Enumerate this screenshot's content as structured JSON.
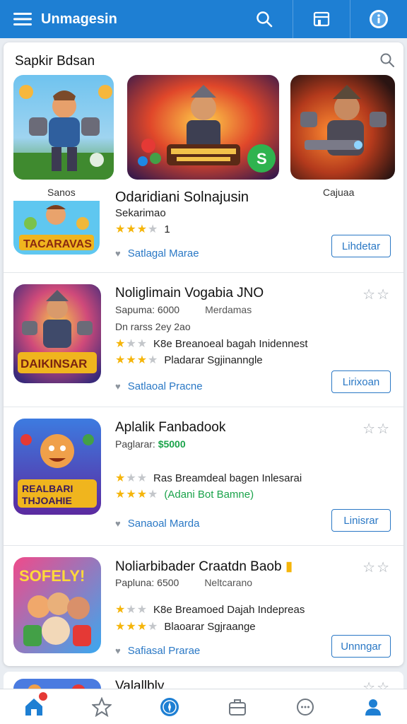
{
  "header": {
    "title": "Unmagesin",
    "menu_icon": "menu-icon",
    "search_icon": "search-icon",
    "store_icon": "store-icon",
    "info_icon": "info-icon",
    "color": "#1e7fd3"
  },
  "panel": {
    "title": "Sapkir Bdsan",
    "search_icon": "search-icon"
  },
  "featured": [
    {
      "label": "Sanos"
    },
    {
      "label": ""
    },
    {
      "label": "Cajuaa"
    }
  ],
  "partial": {
    "name": "Odaridiani Solnajusin",
    "sub": "Sekarimao",
    "rating": "1",
    "meta": "Satlagal Marae",
    "button": "Lihdetar"
  },
  "apps": [
    {
      "name": "Noliglimain Vogabia JNO",
      "l1": "Sapuma: 6000",
      "l1b": "Merdamas",
      "l2": "Dn rarss 2ey 2ao",
      "l3": "K8e Breanoeal bagah Inidennest",
      "l4": "Pladarar Sgjinanngle",
      "meta": "Satlaoal Pracne",
      "button": "Lirixoan"
    },
    {
      "name": "Aplalik Fanbadook",
      "l1": "Paglarar:",
      "price": "$5000",
      "l3": "Ras Breamdeal bagen Inlesarai",
      "l4": "(Adani Bot Bamne)",
      "meta": "Sanaoal Marda",
      "button": "Linisrar"
    },
    {
      "name": "Noliarbibader Craatdn Baob",
      "l1": "Papluna: 6500",
      "l1b": "Neltcarano",
      "l3": "K8e Breamoed Dajah Indepreas",
      "l4": "Blaoarar Sgjraange",
      "meta": "Safiasal Prarae",
      "button": "Unnngar"
    }
  ],
  "peek": {
    "name": "Valallbly"
  },
  "bottom_nav": [
    {
      "name": "home-icon"
    },
    {
      "name": "star-icon"
    },
    {
      "name": "compass-icon"
    },
    {
      "name": "briefcase-icon"
    },
    {
      "name": "chat-icon"
    },
    {
      "name": "profile-icon"
    }
  ]
}
